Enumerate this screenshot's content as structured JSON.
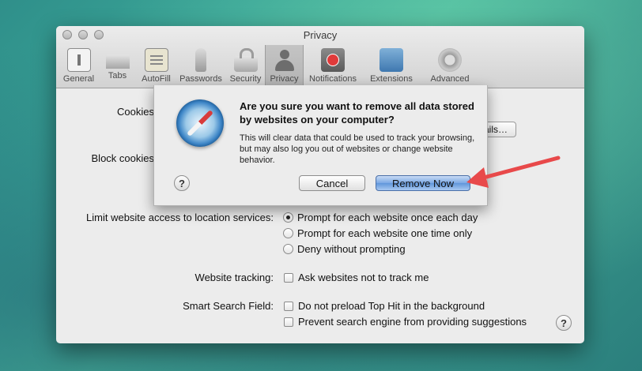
{
  "window": {
    "title": "Privacy"
  },
  "toolbar": {
    "items": [
      {
        "label": "General",
        "icon": "general-switch-icon"
      },
      {
        "label": "Tabs",
        "icon": "tabs-icon"
      },
      {
        "label": "AutoFill",
        "icon": "autofill-form-icon"
      },
      {
        "label": "Passwords",
        "icon": "key-icon"
      },
      {
        "label": "Security",
        "icon": "padlock-icon"
      },
      {
        "label": "Privacy",
        "icon": "person-silhouette-icon",
        "selected": true
      },
      {
        "label": "Notifications",
        "icon": "notification-badge-icon"
      },
      {
        "label": "Extensions",
        "icon": "puzzle-icon"
      },
      {
        "label": "Advanced",
        "icon": "gear-icon"
      }
    ]
  },
  "privacy": {
    "cookies_label": "Cookies",
    "details_button": "…ails…",
    "block_cookies_label": "Block cookies",
    "location_label": "Limit website access to location services:",
    "location_options": [
      {
        "label": "Prompt for each website once each day",
        "selected": true
      },
      {
        "label": "Prompt for each website one time only",
        "selected": false
      },
      {
        "label": "Deny without prompting",
        "selected": false
      }
    ],
    "tracking_label": "Website tracking:",
    "tracking_option": "Ask websites not to track me",
    "smart_search_label": "Smart Search Field:",
    "smart_search_options": [
      "Do not preload Top Hit in the background",
      "Prevent search engine from providing suggestions"
    ],
    "help_glyph": "?"
  },
  "sheet": {
    "title": "Are you sure you want to remove all data stored by websites on your computer?",
    "body": "This will clear data that could be used to track your browsing, but may also log you out of websites or change website behavior.",
    "help_glyph": "?",
    "cancel_label": "Cancel",
    "remove_label": "Remove Now"
  },
  "colors": {
    "annotation_arrow": "#e8494a",
    "default_button": "#6096db"
  }
}
